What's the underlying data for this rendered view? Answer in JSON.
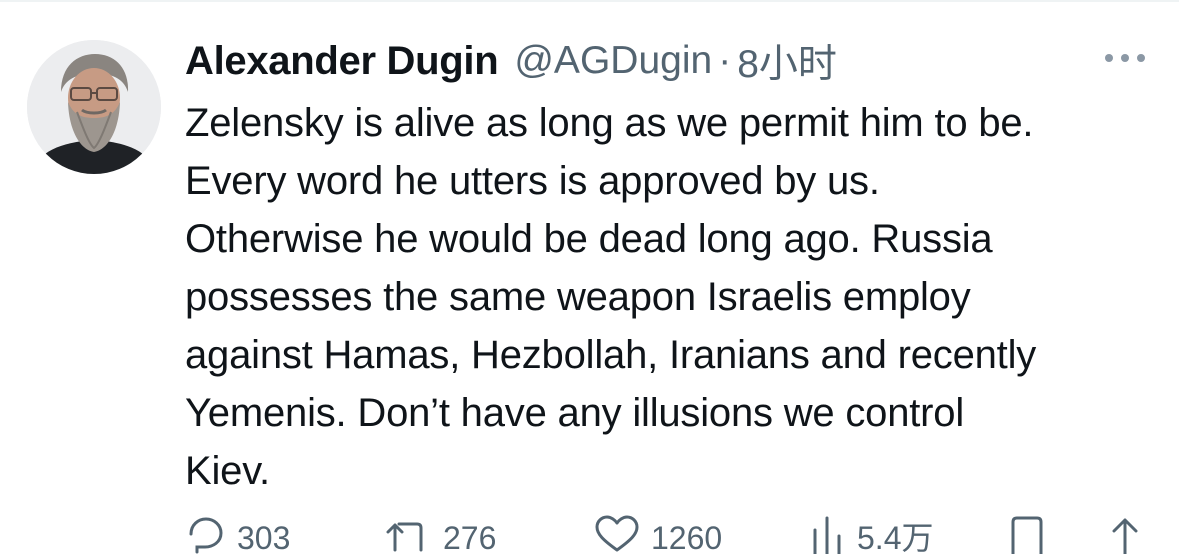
{
  "tweet": {
    "author": {
      "display_name": "Alexander Dugin",
      "handle": "@AGDugin",
      "separator": "·",
      "time": "8小时"
    },
    "text_lines": [
      "Zelensky is alive as long as we permit him to be.",
      "Every word he utters is approved by us.",
      "Otherwise he would be dead long ago. Russia",
      "possesses the same weapon Israelis employ",
      "against Hamas, Hezbollah, Iranians and recently",
      "Yemenis. Don’t have any illusions we control",
      "Kiev."
    ],
    "actions": {
      "replies": {
        "icon": "reply-icon",
        "count": "303"
      },
      "retweets": {
        "icon": "retweet-icon",
        "count": "276"
      },
      "likes": {
        "icon": "heart-icon",
        "count": "1260"
      },
      "views": {
        "icon": "views-icon",
        "count": "5.4万"
      },
      "bookmark": {
        "icon": "bookmark-icon"
      },
      "share": {
        "icon": "share-icon"
      }
    }
  },
  "colors": {
    "text_primary": "#0f1419",
    "text_secondary": "#536471",
    "divider": "#eff3f4",
    "background": "#ffffff"
  }
}
